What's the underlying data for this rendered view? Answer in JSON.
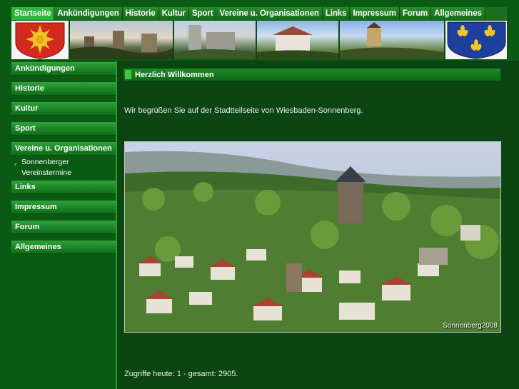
{
  "top_nav": [
    "Startseite",
    "Ankündigungen",
    "Historie",
    "Kultur",
    "Sport",
    "Vereine u. Organisationen",
    "Links",
    "Impressum",
    "Forum",
    "Allgemeines"
  ],
  "sidebar": {
    "items": [
      "Ankündigungen",
      "Historie",
      "Kultur",
      "Sport",
      "Vereine u. Organisationen"
    ],
    "subitem": [
      "Sonnenberger",
      "Vereinstermine"
    ],
    "items2": [
      "Links",
      "Impressum",
      "Forum",
      "Allgemeines"
    ]
  },
  "main": {
    "heading": "Herzlich Willkommen",
    "intro": "Wir begrüßen Sie auf der Stadtteilseite von Wiesbaden-Sonnenberg.",
    "photo_caption": "Sonnenberg2008",
    "counter": "Zugriffe heute: 1 - gesamt: 2905."
  },
  "colors": {
    "background": "#0a5a14",
    "accent": "#2fb63a"
  }
}
